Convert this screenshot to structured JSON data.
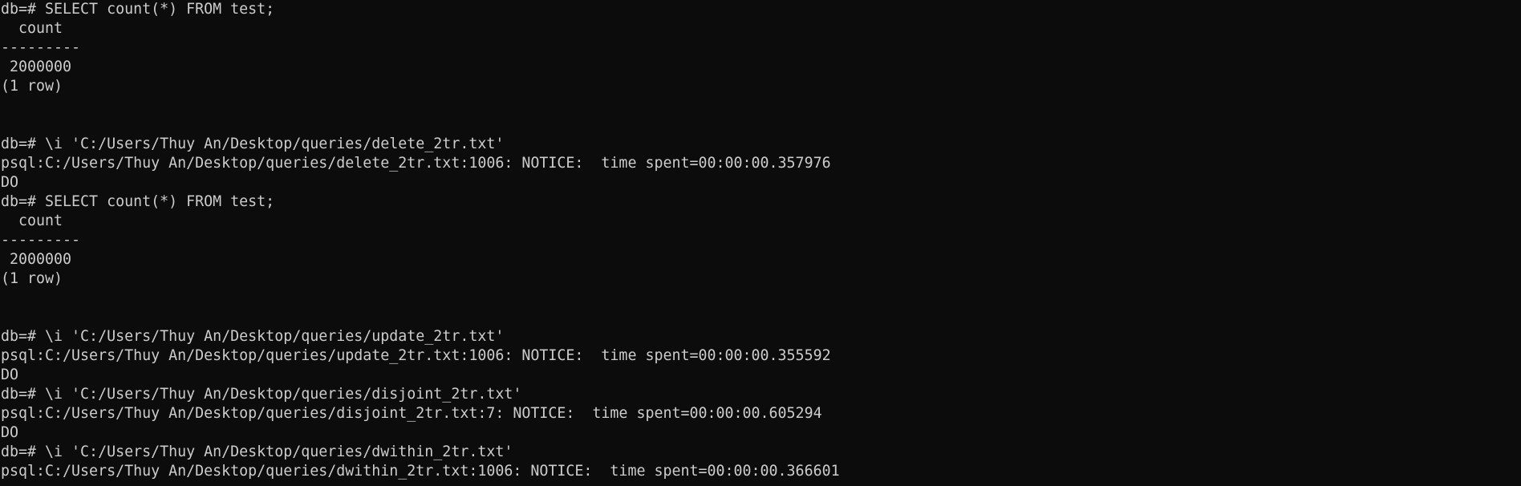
{
  "terminal": {
    "lines": [
      "db=# SELECT count(*) FROM test;",
      "  count",
      "---------",
      " 2000000",
      "(1 row)",
      "",
      "",
      "db=# \\i 'C:/Users/Thuy An/Desktop/queries/delete_2tr.txt'",
      "psql:C:/Users/Thuy An/Desktop/queries/delete_2tr.txt:1006: NOTICE:  time spent=00:00:00.357976",
      "DO",
      "db=# SELECT count(*) FROM test;",
      "  count",
      "---------",
      " 2000000",
      "(1 row)",
      "",
      "",
      "db=# \\i 'C:/Users/Thuy An/Desktop/queries/update_2tr.txt'",
      "psql:C:/Users/Thuy An/Desktop/queries/update_2tr.txt:1006: NOTICE:  time spent=00:00:00.355592",
      "DO",
      "db=# \\i 'C:/Users/Thuy An/Desktop/queries/disjoint_2tr.txt'",
      "psql:C:/Users/Thuy An/Desktop/queries/disjoint_2tr.txt:7: NOTICE:  time spent=00:00:00.605294",
      "DO",
      "db=# \\i 'C:/Users/Thuy An/Desktop/queries/dwithin_2tr.txt'",
      "psql:C:/Users/Thuy An/Desktop/queries/dwithin_2tr.txt:1006: NOTICE:  time spent=00:00:00.366601"
    ]
  }
}
